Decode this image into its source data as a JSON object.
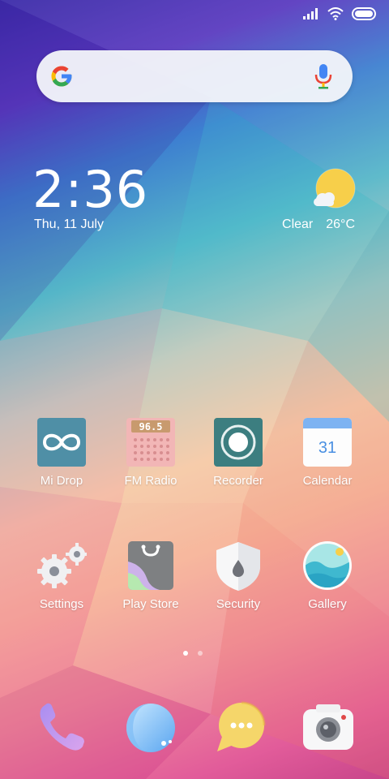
{
  "status_bar": {
    "icons": [
      "signal-icon",
      "wifi-icon",
      "battery-icon"
    ]
  },
  "search": {
    "logo": "google-logo",
    "mic_icon": "mic-icon"
  },
  "clock_widget": {
    "time": "2:36",
    "date": "Thu, 11 July"
  },
  "weather_widget": {
    "icon": "sun-cloud-icon",
    "condition": "Clear",
    "temperature": "26°C"
  },
  "apps": [
    {
      "label": "Mi Drop",
      "icon": "mi-drop-icon"
    },
    {
      "label": "FM Radio",
      "icon": "fm-radio-icon",
      "display": "96.5"
    },
    {
      "label": "Recorder",
      "icon": "recorder-icon"
    },
    {
      "label": "Calendar",
      "icon": "calendar-icon",
      "day": "31"
    },
    {
      "label": "Settings",
      "icon": "settings-icon"
    },
    {
      "label": "Play Store",
      "icon": "play-store-icon"
    },
    {
      "label": "Security",
      "icon": "security-icon"
    },
    {
      "label": "Gallery",
      "icon": "gallery-icon"
    }
  ],
  "page_indicator": {
    "pages": 2,
    "current": 1
  },
  "dock": [
    {
      "icon": "phone-icon"
    },
    {
      "icon": "browser-icon"
    },
    {
      "icon": "messaging-icon"
    },
    {
      "icon": "camera-icon"
    }
  ],
  "colors": {
    "accent_yellow": "#f7cf4a",
    "google_blue": "#4285F4",
    "google_red": "#EA4335",
    "google_yellow": "#FBBC05",
    "google_green": "#34A853"
  }
}
